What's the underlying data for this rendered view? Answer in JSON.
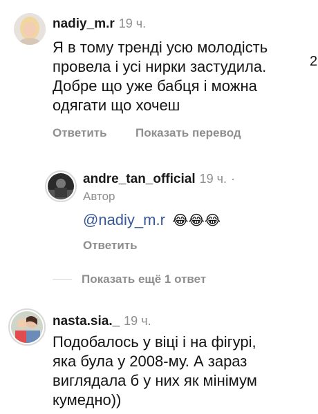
{
  "comment1": {
    "username": "nadiy_m.r",
    "time": "19 ч.",
    "lines": [
      "Я в тому тренді усю молодість",
      "провела і усі нирки застудила.",
      "Добре що уже бабця і можна",
      "одягати що хочеш"
    ],
    "reply_label": "Ответить",
    "translate_label": "Показать перевод"
  },
  "reply": {
    "username": "andre_tan_official",
    "time": "19 ч.",
    "separator": "·",
    "author_label": "Автор",
    "mention": "@nadiy_m.r",
    "emoji": "😂😂😂",
    "reply_label": "Ответить"
  },
  "more_replies_label": "Показать ещё 1 ответ",
  "comment2": {
    "username": "nasta.sia._",
    "time": "19 ч.",
    "lines": [
      "Подобалось у віці і на фігурі,",
      "яка була у 2008-му. А зараз",
      "виглядала б у них як мінімум",
      "кумедно))"
    ]
  },
  "colors": {
    "text": "#151515",
    "muted": "#8e8e8e",
    "mention": "#385898",
    "story_ring": "#d9d9d9"
  }
}
